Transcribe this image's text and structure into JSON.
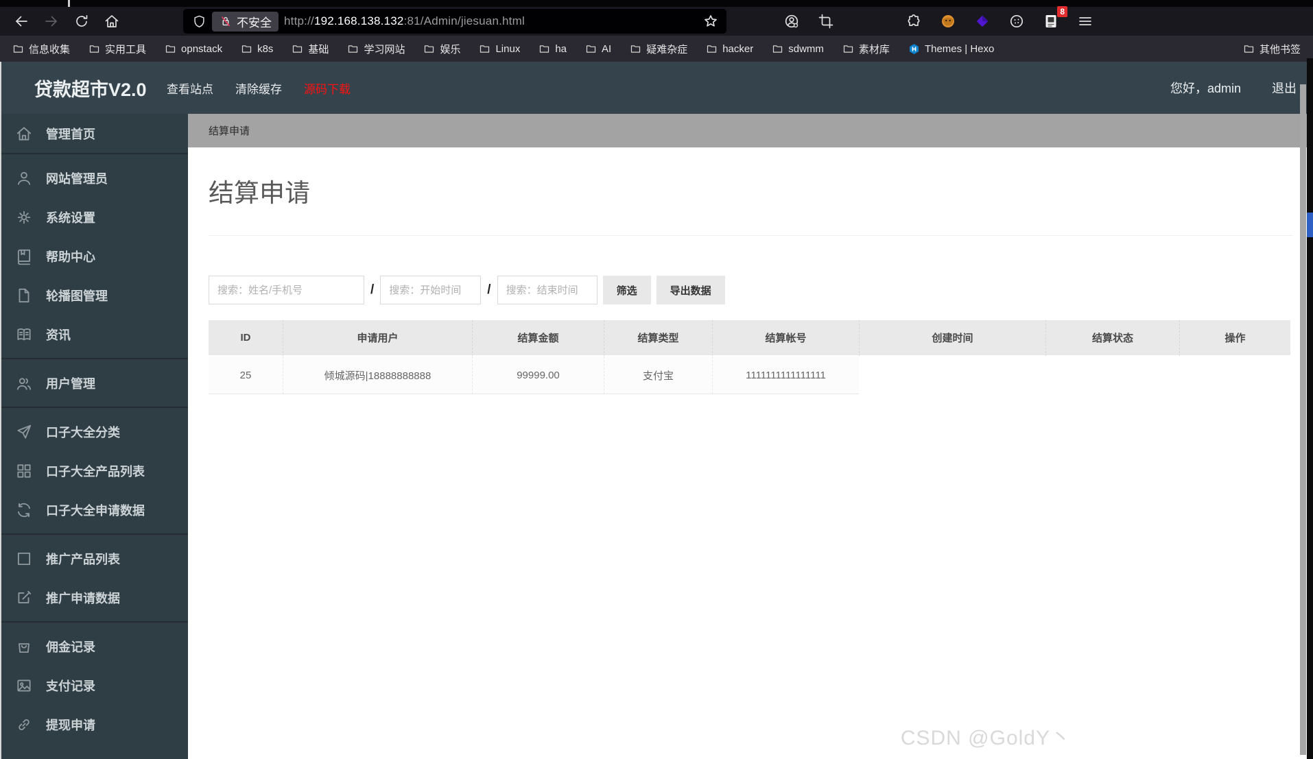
{
  "browser": {
    "toolbar": {
      "security_label": "不安全",
      "url_scheme": "http://",
      "url_host": "192.168.138.132",
      "url_path": ":81/Admin/jiesuan.html",
      "extension_badge": "8"
    },
    "bookmarks": [
      {
        "label": "信息收集",
        "icon": "folder-icon"
      },
      {
        "label": "实用工具",
        "icon": "folder-icon"
      },
      {
        "label": "opnstack",
        "icon": "folder-icon"
      },
      {
        "label": "k8s",
        "icon": "folder-icon"
      },
      {
        "label": "基础",
        "icon": "folder-icon"
      },
      {
        "label": "学习网站",
        "icon": "folder-icon"
      },
      {
        "label": "娱乐",
        "icon": "folder-icon"
      },
      {
        "label": "Linux",
        "icon": "folder-icon"
      },
      {
        "label": "ha",
        "icon": "folder-icon"
      },
      {
        "label": "AI",
        "icon": "folder-icon"
      },
      {
        "label": "疑难杂症",
        "icon": "folder-icon"
      },
      {
        "label": "hacker",
        "icon": "folder-icon"
      },
      {
        "label": "sdwmm",
        "icon": "folder-icon"
      },
      {
        "label": "素材库",
        "icon": "folder-icon"
      },
      {
        "label": "Themes | Hexo",
        "icon": "hexo-icon"
      }
    ],
    "other_bookmarks_label": "其他书签"
  },
  "admin": {
    "brand": "贷款超市V2.0",
    "nav_links": [
      {
        "label": "查看站点",
        "style": "light"
      },
      {
        "label": "清除缓存",
        "style": "light"
      },
      {
        "label": "源码下载",
        "style": "red"
      }
    ],
    "greeting": "您好，admin",
    "logout_label": "退出",
    "breadcrumb": "结算申请",
    "sidebar_groups": [
      [
        {
          "icon": "home-icon",
          "label": "管理首页"
        }
      ],
      [
        {
          "icon": "user-icon",
          "label": "网站管理员"
        },
        {
          "icon": "gear-icon",
          "label": "系统设置"
        },
        {
          "icon": "book-icon",
          "label": "帮助中心"
        },
        {
          "icon": "file-icon",
          "label": "轮播图管理"
        },
        {
          "icon": "news-icon",
          "label": "资讯"
        }
      ],
      [
        {
          "icon": "users-icon",
          "label": "用户管理"
        }
      ],
      [
        {
          "icon": "send-icon",
          "label": "口子大全分类"
        },
        {
          "icon": "grid-icon",
          "label": "口子大全产品列表"
        },
        {
          "icon": "refresh-icon",
          "label": "口子大全申请数据"
        }
      ],
      [
        {
          "icon": "square-icon",
          "label": "推广产品列表"
        },
        {
          "icon": "edit-icon",
          "label": "推广申请数据"
        }
      ],
      [
        {
          "icon": "bag-icon",
          "label": "佣金记录"
        },
        {
          "icon": "image-icon",
          "label": "支付记录"
        },
        {
          "icon": "link-icon",
          "label": "提现申请"
        }
      ]
    ],
    "page": {
      "title": "结算申请",
      "separator": "/",
      "search_inputs": [
        {
          "name": "search-keyword-input",
          "placeholder": "搜索：姓名/手机号"
        },
        {
          "name": "search-start-time-input",
          "placeholder": "搜索：开始时间"
        },
        {
          "name": "search-end-time-input",
          "placeholder": "搜索：结束时间"
        }
      ],
      "filter_button": "筛选",
      "export_button": "导出数据",
      "table": {
        "headers": [
          "ID",
          "申请用户",
          "结算金额",
          "结算类型",
          "结算帐号",
          "创建时间",
          "结算状态",
          "操作"
        ],
        "rows": [
          {
            "cells": [
              "25",
              "倾城源码|18888888888",
              "99999.00",
              "支付宝",
              "1111111111111111",
              "",
              "",
              ""
            ]
          }
        ]
      }
    }
  },
  "watermark": "CSDN @GoldY丶",
  "colors": {
    "accent_red": "#ff1111",
    "header_bg": "#35434c",
    "sidebar_bg": "#2f3d44",
    "breadcrumb_bg": "#a3a3a3",
    "table_header_bg": "#e9e9e9",
    "edge_blue": "#2e5fc2"
  }
}
